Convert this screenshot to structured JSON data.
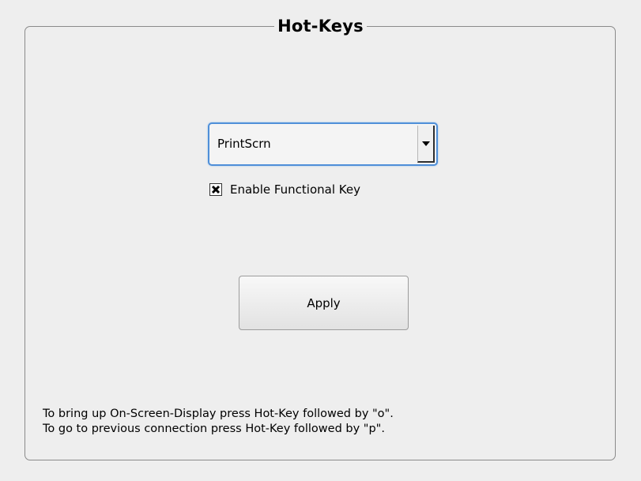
{
  "group": {
    "title": "Hot-Keys"
  },
  "hotkey_select": {
    "value": "PrintScrn",
    "arrow_icon": "triangle-down-icon"
  },
  "enable_checkbox": {
    "checked": true,
    "label": "Enable Functional Key"
  },
  "apply_button": {
    "label": "Apply"
  },
  "info": {
    "line1": "To bring up On-Screen-Display press Hot-Key followed by \"o\".",
    "line2": "To go to previous connection press Hot-Key followed by \"p\"."
  },
  "colors": {
    "background": "#eeeeee",
    "focus_border": "#4f8fd8",
    "frame_border": "#8a8a8a"
  }
}
